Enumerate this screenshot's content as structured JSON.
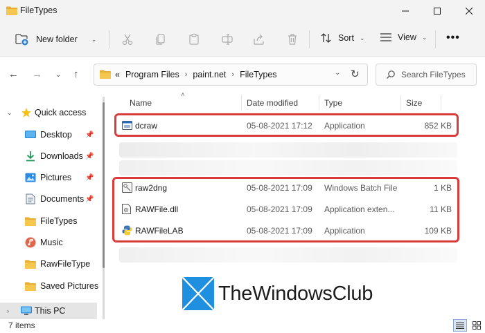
{
  "window": {
    "title": "FileTypes"
  },
  "toolbar": {
    "new_folder_label": "New folder",
    "sort_label": "Sort",
    "view_label": "View",
    "more_label": "•••"
  },
  "address": {
    "prefix": "«",
    "crumbs": [
      "Program Files",
      "paint.net",
      "FileTypes"
    ]
  },
  "search": {
    "placeholder": "Search FileTypes"
  },
  "sidebar": {
    "quick_access": "Quick access",
    "items": [
      {
        "label": "Desktop",
        "icon": "desktop-icon",
        "pinned": true
      },
      {
        "label": "Downloads",
        "icon": "download-icon",
        "pinned": true
      },
      {
        "label": "Pictures",
        "icon": "pictures-icon",
        "pinned": true
      },
      {
        "label": "Documents",
        "icon": "documents-icon",
        "pinned": true
      },
      {
        "label": "FileTypes",
        "icon": "folder-icon",
        "pinned": false
      },
      {
        "label": "Music",
        "icon": "music-icon",
        "pinned": false
      },
      {
        "label": "RawFileType",
        "icon": "folder-icon",
        "pinned": false
      },
      {
        "label": "Saved Pictures",
        "icon": "folder-icon",
        "pinned": false
      }
    ],
    "this_pc": "This PC"
  },
  "columns": {
    "name": "Name",
    "date": "Date modified",
    "type": "Type",
    "size": "Size"
  },
  "files": [
    {
      "name": "dcraw",
      "date": "05-08-2021 17:12",
      "type": "Application",
      "size": "852 KB",
      "icon": "application-icon"
    },
    {
      "name": "raw2dng",
      "date": "05-08-2021 17:09",
      "type": "Windows Batch File",
      "size": "1 KB",
      "icon": "batch-file-icon"
    },
    {
      "name": "RAWFile.dll",
      "date": "05-08-2021 17:09",
      "type": "Application exten...",
      "size": "11 KB",
      "icon": "dll-file-icon"
    },
    {
      "name": "RAWFileLAB",
      "date": "05-08-2021 17:09",
      "type": "Application",
      "size": "109 KB",
      "icon": "python-app-icon"
    }
  ],
  "watermark": {
    "text": "TheWindowsClub"
  },
  "status": {
    "count": "7 items"
  },
  "colors": {
    "highlight": "#d93b3b",
    "folder": "#f2c14e",
    "accent": "#0067c0"
  }
}
